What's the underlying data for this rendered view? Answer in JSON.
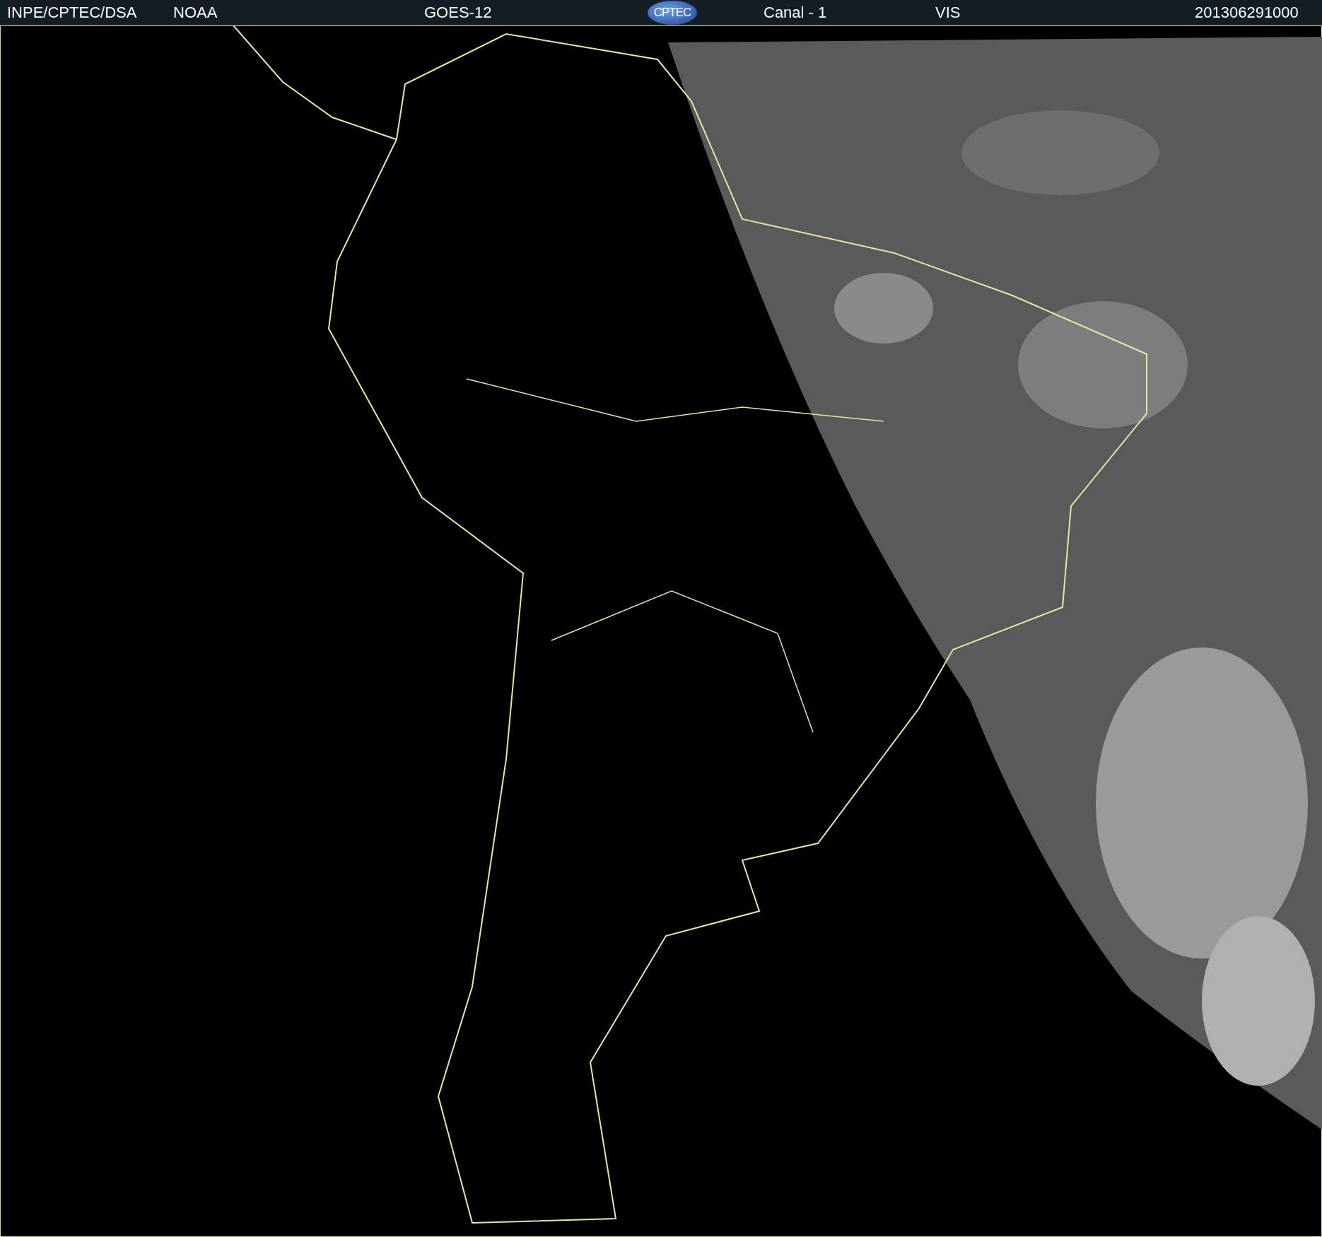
{
  "header": {
    "source": "INPE/CPTEC/DSA",
    "agency": "NOAA",
    "satellite": "GOES-12",
    "logo": "CPTEC",
    "channel": "Canal - 1",
    "band": "VIS",
    "timestamp": "201306291000"
  }
}
